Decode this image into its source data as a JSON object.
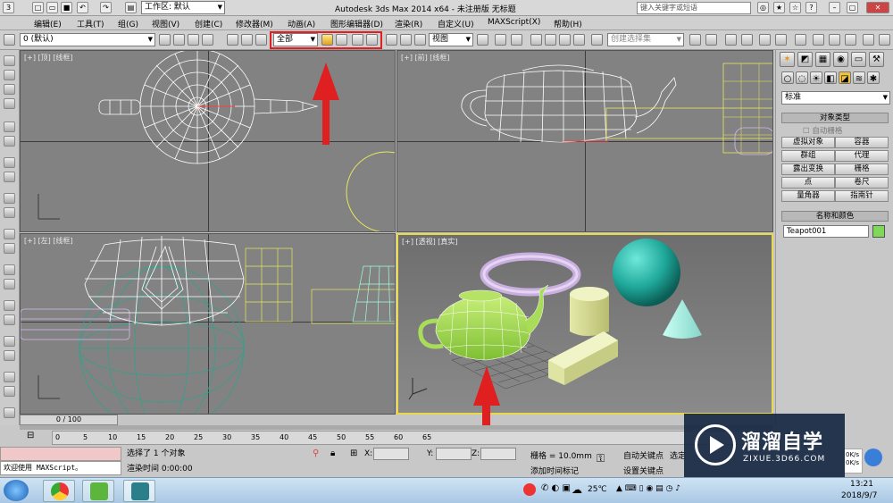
{
  "window": {
    "title": "Autodesk 3ds Max  2014 x64    - 未注册版    无标题",
    "workspace_label": "工作区: 默认",
    "search_placeholder": "键入关键字或短语"
  },
  "menu": [
    "编辑(E)",
    "工具(T)",
    "组(G)",
    "视图(V)",
    "创建(C)",
    "修改器(M)",
    "动画(A)",
    "图形编辑器(D)",
    "渲染(R)",
    "自定义(U)",
    "MAXScript(X)",
    "帮助(H)"
  ],
  "toolbar": {
    "layer_value": "0 (默认)",
    "filter_value": "全部",
    "refcoord_value": "视图",
    "selection_set_placeholder": "创建选择集"
  },
  "viewports": {
    "top_left": "[+] [顶] [线框]",
    "top_right": "[+] [前] [线框]",
    "bottom_left": "[+] [左] [线框]",
    "bottom_right": "[+] [透视] [真实]"
  },
  "command_panel": {
    "category_value": "标准",
    "object_type_title": "对象类型",
    "autogrid_label": "自动栅格",
    "buttons": [
      "虚拟对象",
      "容器",
      "群组",
      "代理",
      "露出变换",
      "栅格",
      "点",
      "卷尺",
      "量角器",
      "指南针"
    ],
    "name_color_title": "名称和颜色",
    "object_name": "Teapot001",
    "object_color": "#7ed957"
  },
  "timeline": {
    "frame_counter": "0 / 100",
    "ticks": [
      "0",
      "5",
      "10",
      "15",
      "20",
      "25",
      "30",
      "35",
      "40",
      "45",
      "50",
      "55",
      "60",
      "65"
    ]
  },
  "status": {
    "script_welcome": "欢迎使用 MAXScript。",
    "selection_text": "选择了 1 个对象",
    "render_time": "渲染时间  0:00:00",
    "x_label": "X:",
    "y_label": "Y:",
    "z_label": "Z:",
    "grid_text": "栅格 = 10.0mm",
    "add_time_tag": "添加时间标记",
    "auto_key": "自动关键点",
    "set_key": "设置关键点",
    "selected_short": "选定"
  },
  "taskbar": {
    "temperature": "25℃",
    "time": "13:21",
    "date": "2018/9/7"
  },
  "watermark": {
    "brand": "溜溜自学",
    "url": "ZIXUE.3D66.COM"
  },
  "colors": {
    "highlight_red": "#e02020",
    "active_viewport_border": "#e8d84a",
    "teapot_green": "#9bd44a"
  }
}
